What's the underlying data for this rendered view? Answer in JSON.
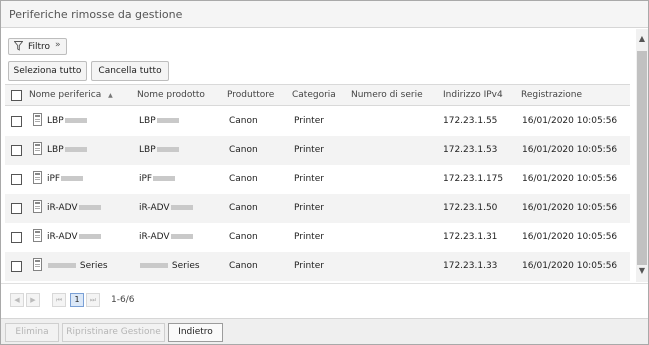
{
  "window": {
    "title": "Periferiche rimosse da gestione"
  },
  "toolbar": {
    "filter_label": "Filtro",
    "filter_icon": "funnel-icon",
    "filter_chevron": "»",
    "select_all": "Seleziona tutto",
    "clear_all": "Cancella tutto"
  },
  "table": {
    "columns": [
      "Nome periferica",
      "Nome prodotto",
      "Produttore",
      "Categoria",
      "Numero di serie",
      "Indirizzo IPv4",
      "Registrazione"
    ],
    "sort_indicator": "▲",
    "rows": [
      {
        "name": "LBP",
        "product": "LBP",
        "maker": "Canon",
        "category": "Printer",
        "serial": "",
        "ip": "172.23.1.55",
        "registered": "16/01/2020 10:05:56"
      },
      {
        "name": "LBP",
        "product": "LBP",
        "maker": "Canon",
        "category": "Printer",
        "serial": "",
        "ip": "172.23.1.53",
        "registered": "16/01/2020 10:05:56"
      },
      {
        "name": "iPF",
        "product": "iPF",
        "maker": "Canon",
        "category": "Printer",
        "serial": "",
        "ip": "172.23.1.175",
        "registered": "16/01/2020 10:05:56"
      },
      {
        "name": "iR-ADV",
        "product": "iR-ADV",
        "maker": "Canon",
        "category": "Printer",
        "serial": "",
        "ip": "172.23.1.50",
        "registered": "16/01/2020 10:05:56"
      },
      {
        "name": "iR-ADV",
        "product": "iR-ADV",
        "maker": "Canon",
        "category": "Printer",
        "serial": "",
        "ip": "172.23.1.31",
        "registered": "16/01/2020 10:05:56"
      },
      {
        "name": "Series",
        "product": "Series",
        "maker": "Canon",
        "category": "Printer",
        "serial": "",
        "ip": "172.23.1.33",
        "registered": "16/01/2020 10:05:56"
      }
    ]
  },
  "pager": {
    "current_page": "1",
    "range": "1-6/6"
  },
  "footer": {
    "delete": "Elimina",
    "restore": "Ripristinare Gestione",
    "back": "Indietro"
  }
}
